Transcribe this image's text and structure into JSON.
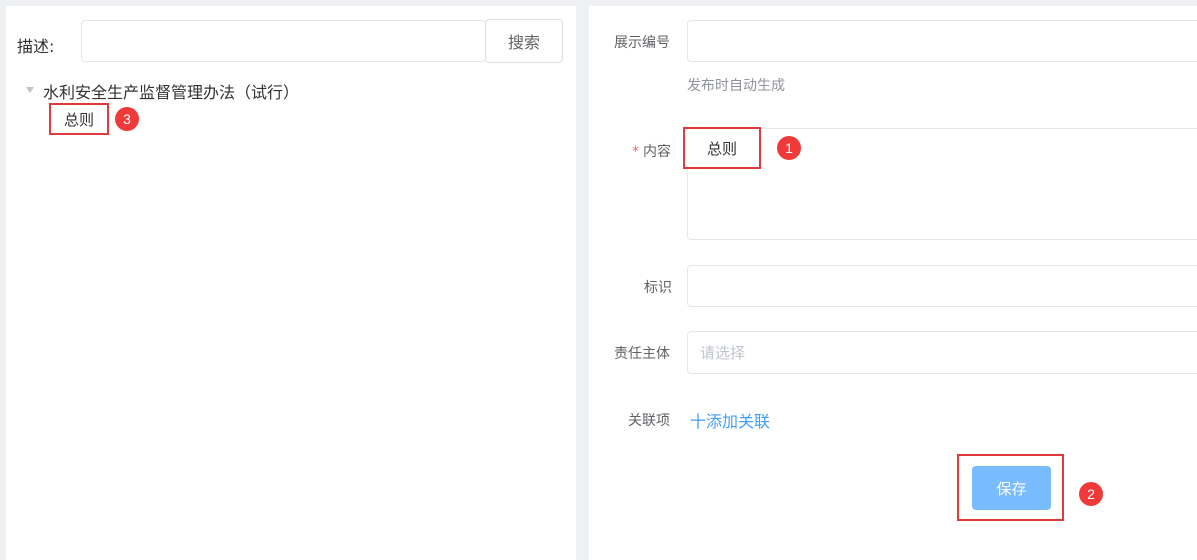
{
  "left": {
    "search": {
      "label": "描述:",
      "value": "",
      "button_label": "搜索"
    },
    "tree": {
      "root_label": "水利安全生产监督管理办法（试行）",
      "children": [
        {
          "label": "总则"
        }
      ]
    }
  },
  "right": {
    "form": {
      "display_no": {
        "label": "展示编号",
        "value": "",
        "hint": "发布时自动生成"
      },
      "content": {
        "required_mark": "*",
        "label": "内容",
        "value": "总则"
      },
      "identifier": {
        "label": "标识",
        "value": ""
      },
      "responsible": {
        "label": "责任主体",
        "placeholder": "请选择"
      },
      "related": {
        "label": "关联项",
        "add_link": "十添加关联"
      },
      "save_label": "保存"
    }
  },
  "annotations": {
    "marker_1": "1",
    "marker_2": "2",
    "marker_3": "3",
    "color": "#f03a3a"
  }
}
